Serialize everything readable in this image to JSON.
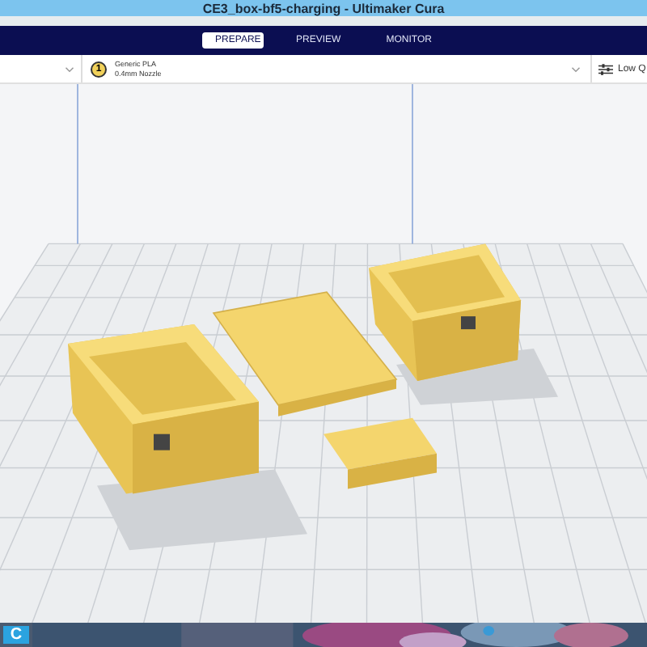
{
  "window": {
    "title": "CE3_box-bf5-charging - Ultimaker Cura"
  },
  "stage_tabs": [
    {
      "label": "PREPARE",
      "selected": true
    },
    {
      "label": "PREVIEW",
      "selected": false
    },
    {
      "label": "MONITOR",
      "selected": false
    }
  ],
  "extruder": {
    "number": "1",
    "material": "Generic PLA",
    "nozzle": "0.4mm Nozzle"
  },
  "print_settings": {
    "profile": "Low Q"
  },
  "taskbar": {
    "app_icon_letter": "C"
  }
}
